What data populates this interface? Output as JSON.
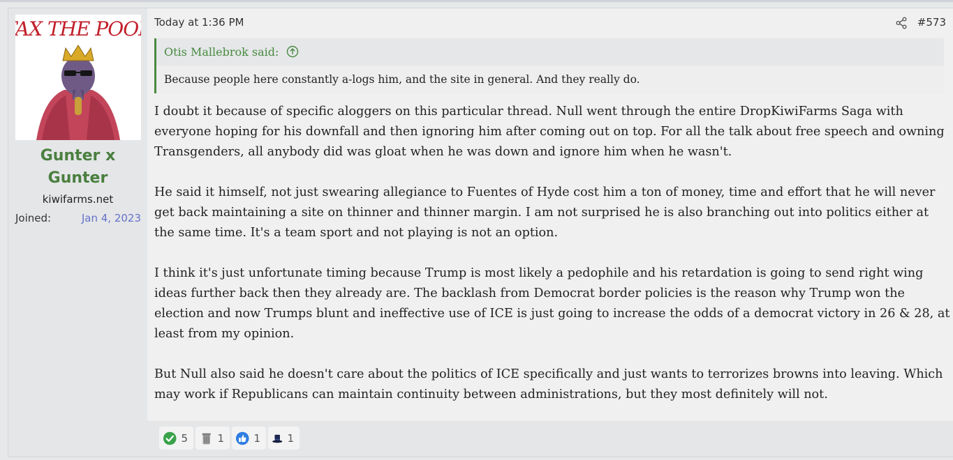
{
  "user": {
    "avatar_caption": "TAX THE POOR",
    "name": "Gunter x Gunter",
    "site": "kiwifarms.net",
    "joined_label": "Joined:",
    "joined_date": "Jan 4, 2023"
  },
  "post": {
    "date": "Today at 1:36 PM",
    "number": "#573",
    "quote": {
      "author": "Otis Mallebrok said:",
      "text": "Because people here constantly a-logs him, and the site in general. And they really do."
    },
    "paragraphs": [
      "I doubt it because of specific aloggers on this particular thread. Null went through the entire DropKiwiFarms Saga with everyone hoping for his downfall and then ignoring him after coming out on top. For all the talk about free speech and owning Transgenders, all anybody did was gloat when he was down and ignore him when he wasn't.",
      "He said it himself, not just swearing allegiance to Fuentes of Hyde cost him a ton of money, time and effort that he will never get back maintaining a site on thinner and thinner margin. I am not surprised he is also branching out into politics either at the same time. It's a team sport and not playing is not an option.",
      "I think it's just unfortunate timing because Trump is most likely a pedophile and his retardation is going to send right wing ideas further back then they already are. The backlash from Democrat border policies is the reason why Trump won the election and now Trumps blunt and ineffective use of ICE is just going to increase the odds of a democrat victory in 26 & 28, at least from my opinion.",
      "But Null also said he doesn't care about the politics of ICE specifically and just wants to terrorizes browns into leaving. Which may work if Republicans can maintain continuity between administrations, but they most definitely will not."
    ]
  },
  "reactions": [
    {
      "icon": "checkmark-icon",
      "count": "5"
    },
    {
      "icon": "trash-can-icon",
      "count": "1"
    },
    {
      "icon": "thumbs-up-icon",
      "count": "1"
    },
    {
      "icon": "top-hat-icon",
      "count": "1"
    }
  ],
  "colors": {
    "accent_green": "#4a7f3f",
    "joined_blue": "#6671c9"
  }
}
